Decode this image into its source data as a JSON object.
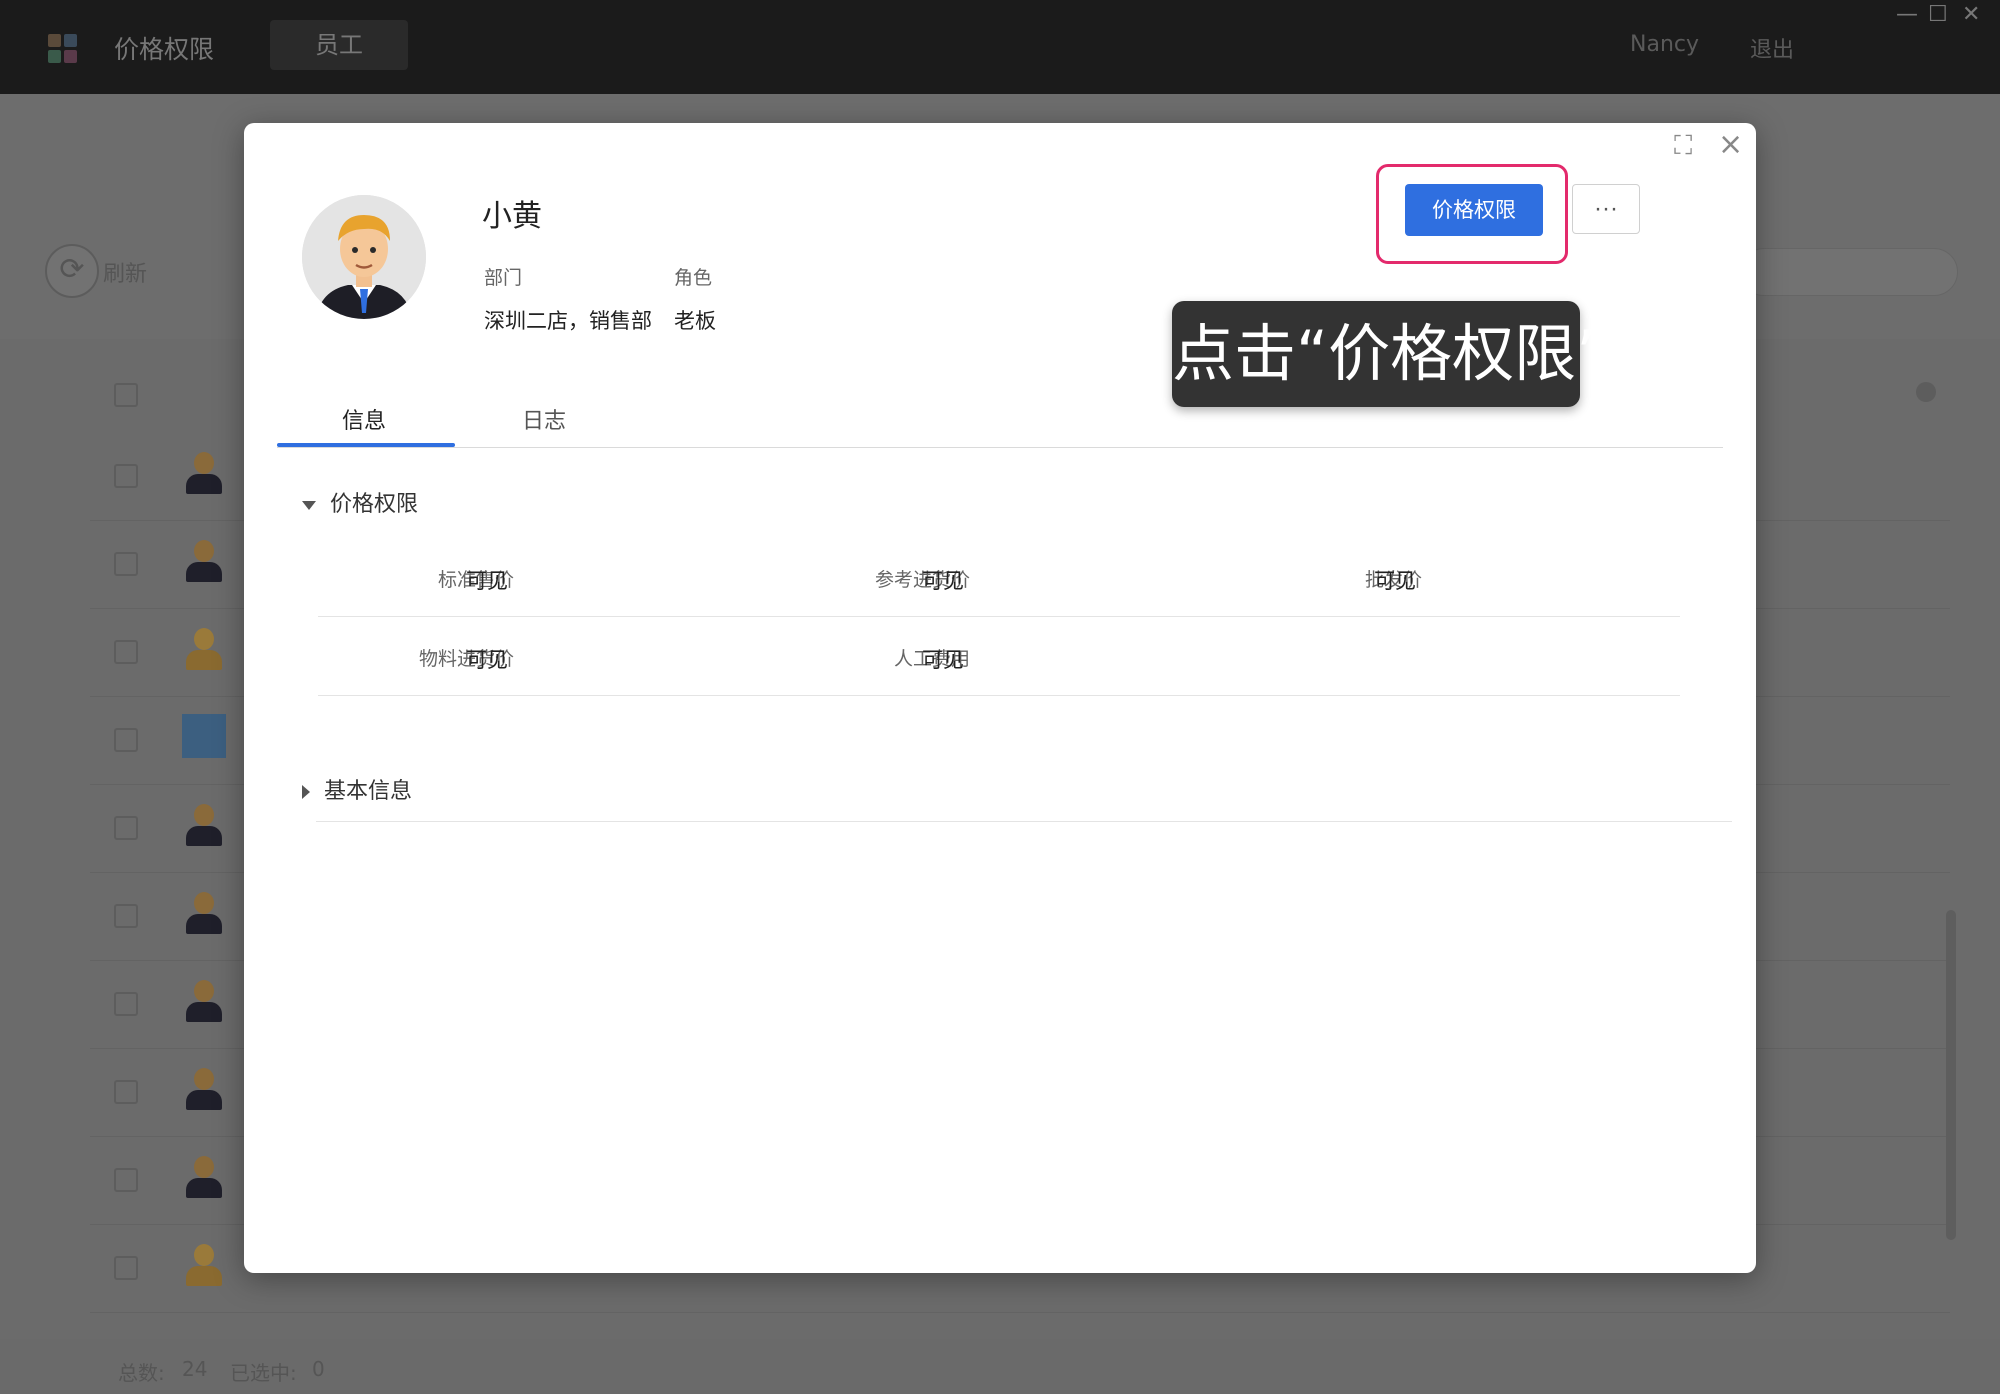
{
  "app": {
    "title": "价格权限",
    "nav_tab": "员工",
    "user_name": "Nancy",
    "logout": "退出",
    "win_minimize": "—",
    "win_maximize": "☐",
    "win_close": "✕"
  },
  "background": {
    "refresh_label": "刷新",
    "footer_total_label": "总数:",
    "footer_total_value": "24",
    "footer_selected_label": "已选中:",
    "footer_selected_value": "0"
  },
  "modal": {
    "expand_icon": "⛶",
    "close_icon": "×",
    "profile": {
      "name": "小黄",
      "dept_label": "部门",
      "dept_value": "深圳二店，销售部",
      "role_label": "角色",
      "role_value": "老板"
    },
    "actions": {
      "primary_label": "价格权限",
      "more_label": "···"
    },
    "tooltip": "点击“价格权限”",
    "tabs": [
      {
        "label": "信息",
        "active": true
      },
      {
        "label": "日志",
        "active": false
      }
    ],
    "price_section": {
      "title": "价格权限",
      "rows": [
        [
          {
            "label": "标准售价",
            "value": "可见"
          },
          {
            "label": "参考进货价",
            "value": "可见"
          },
          {
            "label": "批发价",
            "value": "可见"
          }
        ],
        [
          {
            "label": "物料进货价",
            "value": "可见"
          },
          {
            "label": "人工费用",
            "value": "可见"
          }
        ]
      ]
    },
    "basic_section": {
      "title": "基本信息"
    }
  },
  "colors": {
    "accent": "#2f6fe0",
    "highlight": "#e32a6c",
    "tooltip_bg": "#333333"
  }
}
